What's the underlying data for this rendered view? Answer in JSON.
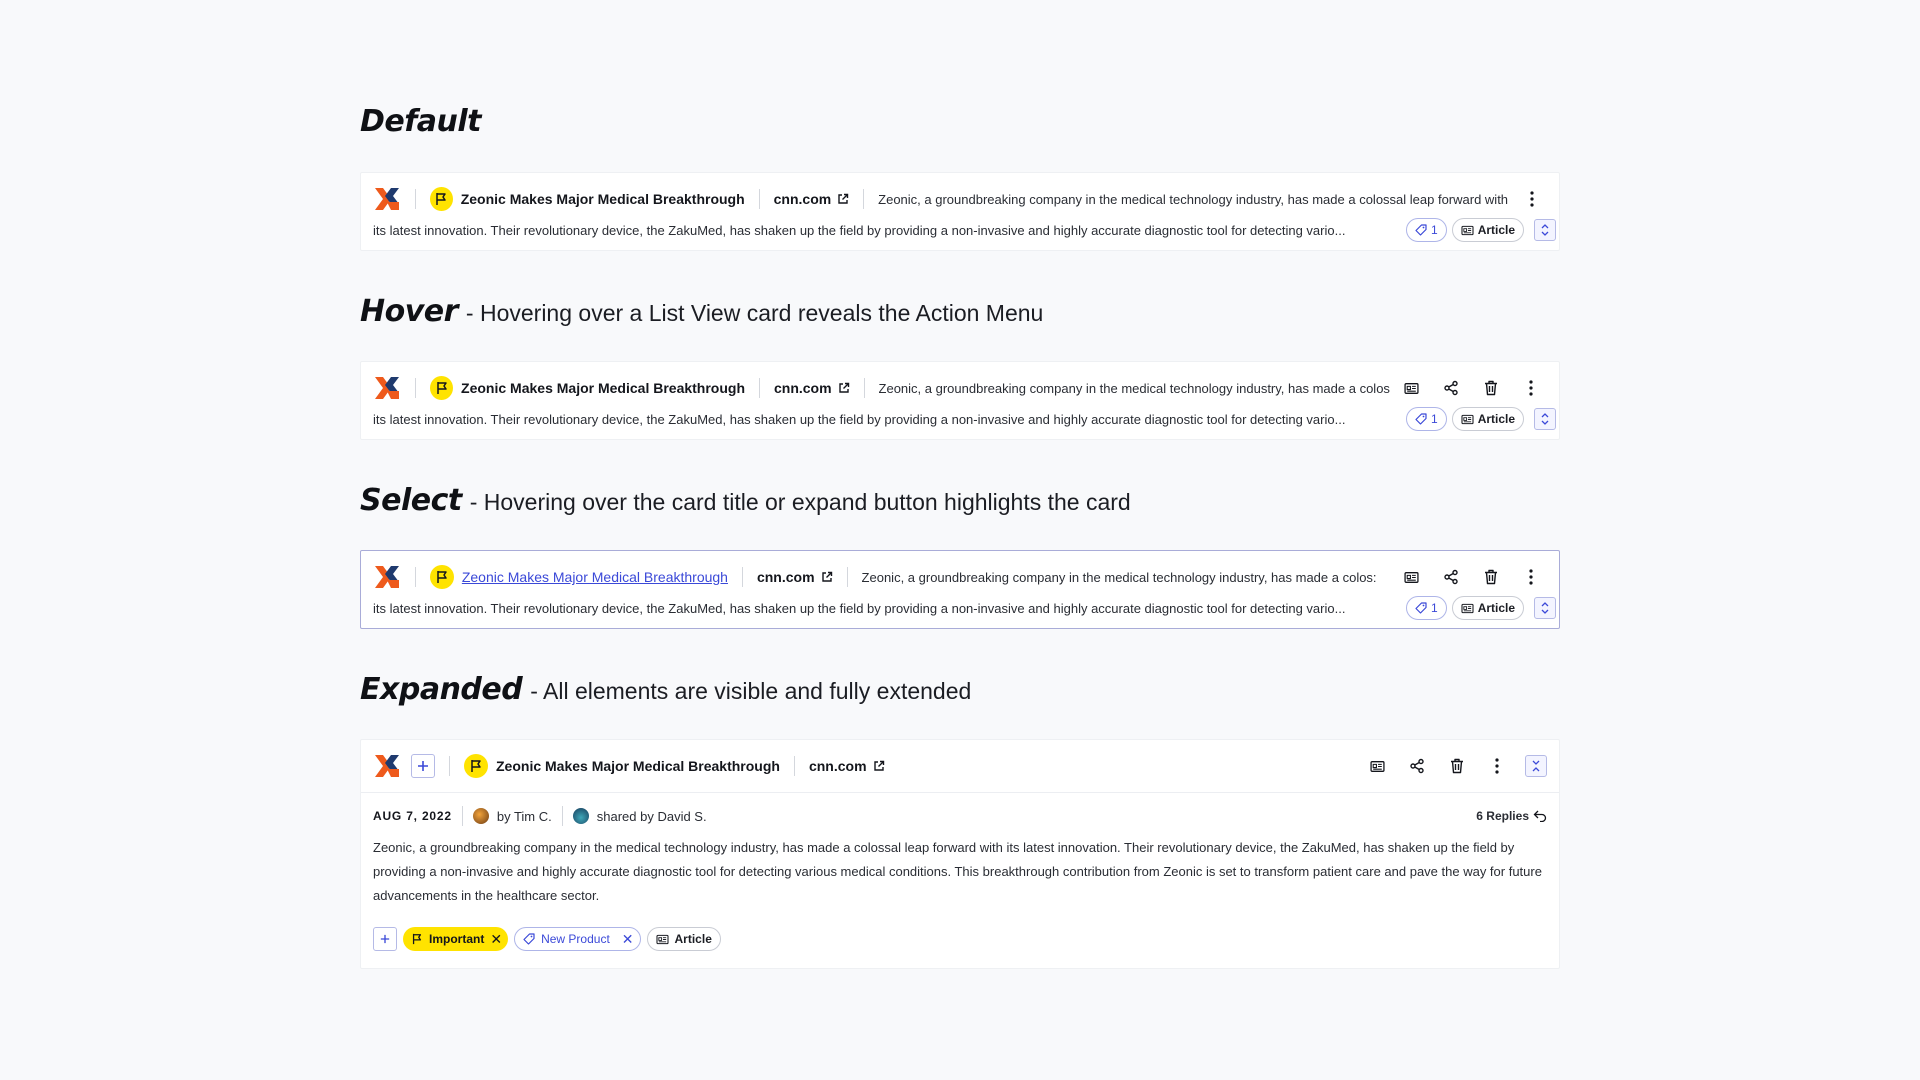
{
  "sections": {
    "default": {
      "state": "Default",
      "desc": ""
    },
    "hover": {
      "state": "Hover",
      "desc": "- Hovering over a List View card reveals the Action Menu"
    },
    "select": {
      "state": "Select",
      "desc": "- Hovering over the card title or expand button highlights the card"
    },
    "expanded": {
      "state": "Expanded",
      "desc": "- All elements are visible and fully extended"
    }
  },
  "card": {
    "title": "Zeonic Makes Major Medical Breakthrough",
    "source": "cnn.com",
    "snippet_line1": "Zeonic, a groundbreaking company in the medical technology industry, has made a colossal leap forward with",
    "snippet_line1_truncated": "Zeonic, a groundbreaking company in the medical technology industry, has made a colos:",
    "snippet_line2": "its latest innovation. Their revolutionary device, the ZakuMed, has shaken up the field by providing a non-invasive and highly accurate diagnostic tool for detecting vario...",
    "tag_count": "1",
    "type_label": "Article",
    "date": "AUG 7, 2022",
    "author": "by Tim C.",
    "shared_by": "shared by David S.",
    "replies": "6 Replies",
    "body": "Zeonic, a groundbreaking company in the medical technology industry, has made a colossal leap forward with its latest innovation. Their revolutionary device, the ZakuMed, has shaken up the field by providing a non-invasive and highly accurate diagnostic tool for detecting various medical conditions. This breakthrough contribution from Zeonic is set to transform patient care and pave the way for future advancements in the healthcare sector.",
    "tags": {
      "important": "Important",
      "new_product": "New Product",
      "article": "Article"
    }
  },
  "colors": {
    "accent": "#3b49d8",
    "flag_yellow": "#ffe300",
    "logo_orange": "#ee5a1c",
    "logo_navy": "#1f3a6e"
  },
  "icons": [
    "logo-icon",
    "flag-icon",
    "external-link-icon",
    "tag-icon",
    "article-icon",
    "share-icon",
    "trash-icon",
    "more-vertical-icon",
    "expand-icon",
    "collapse-icon",
    "plus-icon",
    "reply-icon",
    "close-icon"
  ]
}
